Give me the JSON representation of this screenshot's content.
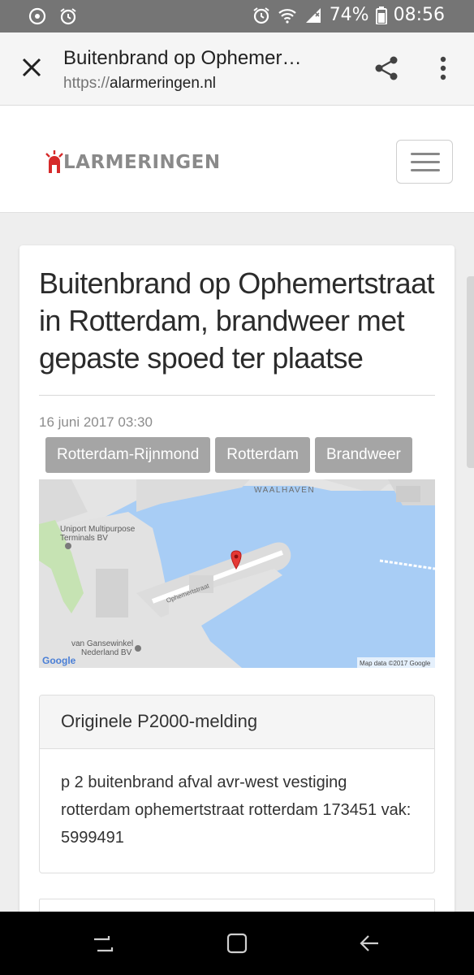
{
  "status_bar": {
    "battery": "74%",
    "time": "08:56"
  },
  "browser": {
    "page_title": "Buitenbrand op Ophemer…",
    "url_scheme": "https://",
    "url_host": "alarmeringen.nl"
  },
  "site": {
    "logo_text": "LARMERINGEN",
    "logo_accent_color": "#d62a2a"
  },
  "article": {
    "headline": "Buitenbrand op Ophemertstraat in Rotterdam, brandweer met gepaste spoed ter plaatse",
    "date": "16 juni 2017 03:30",
    "tags": [
      "Rotterdam-Rijnmond",
      "Rotterdam",
      "Brandweer"
    ]
  },
  "map": {
    "labels": {
      "waalhaven": "WAALHAVEN",
      "uniport_1": "Uniport Multipurpose",
      "uniport_2": "Terminals BV",
      "street": "Ophemertstraat",
      "gansewinkel_1": "van Gansewinkel",
      "gansewinkel_2": "Nederland BV",
      "google": "Google",
      "attribution": "Map data ©2017 Google"
    },
    "water_color": "#a8cdf5"
  },
  "p2000": {
    "heading": "Originele P2000-melding",
    "message": "p 2 buitenbrand afval avr-west vestiging rotterdam ophemertstraat rotterdam 173451 vak: 5999491"
  }
}
